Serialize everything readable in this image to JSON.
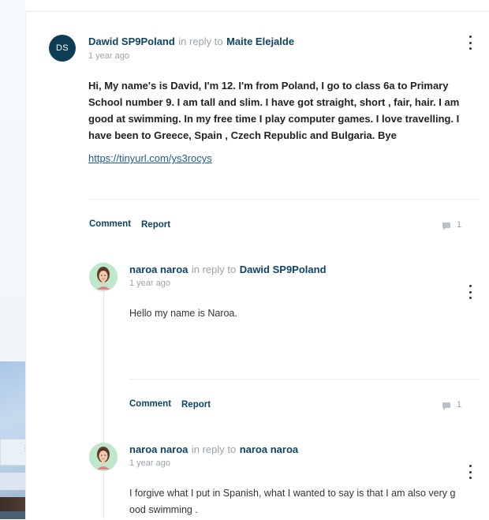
{
  "comment": {
    "avatar_initials": "DS",
    "author": "Dawid SP9Poland",
    "in_reply_to_text": "in reply to",
    "reply_target": "Maite Elejalde",
    "time": "1 year ago",
    "body": "Hi, My name's is David, I'm 12. I'm from Poland, I go to class 6a to Primary School number 9.  I am tall and slim. I have got straight, short , fair, hair. I am good at swimming. In my free time I play computer games. I love travelling. I have been to Greece, Spain , Czech Republic and  Bulgaria. Bye",
    "link": "https://tinyurl.com/ys3rocys",
    "comment_label": "Comment",
    "report_label": "Report",
    "reply_count": "1"
  },
  "replies": [
    {
      "author": "naroa naroa",
      "in_reply_to_text": "in reply to",
      "reply_target": "Dawid SP9Poland",
      "time": "1 year ago",
      "body": "Hello my name is Naroa.",
      "comment_label": "Comment",
      "report_label": "Report",
      "reply_count": "1"
    },
    {
      "author": "naroa naroa",
      "in_reply_to_text": "in reply to",
      "reply_target": "naroa naroa",
      "time": "1 year ago",
      "body_line1": "I forgive what I put in Spanish, what I wanted to say is that I am also very g",
      "body_line2": "ood swimming ."
    }
  ],
  "colors": {
    "accent": "#0d4463",
    "avatar_bg": "#0d3d55",
    "muted": "#9aa3ab"
  }
}
